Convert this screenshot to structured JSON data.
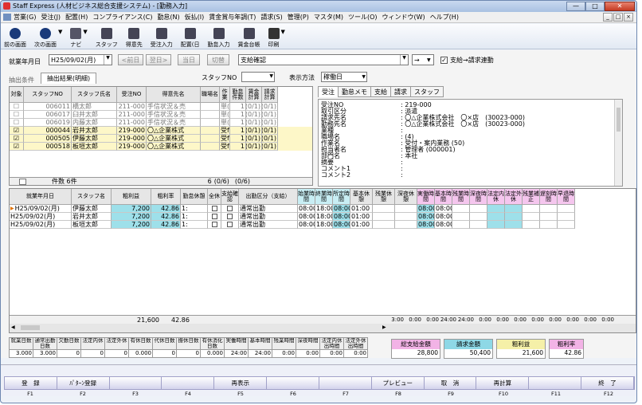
{
  "window": {
    "title": "Staff Express (人材ビジネス総合支援システム) - [勤務入力]",
    "controls": [
      "—",
      "□",
      "✕"
    ],
    "inner_controls": [
      "_",
      "□",
      "×"
    ]
  },
  "menu": [
    "営業(G)",
    "受注(J)",
    "配置(H)",
    "コンプライアンス(C)",
    "勤怠(N)",
    "仮払(I)",
    "賃金賞与年調(T)",
    "請求(S)",
    "管理(P)",
    "マスタ(M)",
    "ツール(O)",
    "ウィンドウ(W)",
    "ヘルプ(H)"
  ],
  "toolbar": [
    {
      "label": "前の画面",
      "icon": "back-arrow-icon"
    },
    {
      "label": "次の画面",
      "icon": "forward-arrow-icon"
    },
    {
      "label": "ナビ",
      "icon": "navi-icon"
    },
    {
      "label": "スタッフ",
      "icon": "staff-icon"
    },
    {
      "label": "得意先",
      "icon": "client-icon"
    },
    {
      "label": "受注入力",
      "icon": "order-entry-icon"
    },
    {
      "label": "配置(日",
      "icon": "placement-icon"
    },
    {
      "label": "勤怠入力",
      "icon": "attendance-icon"
    },
    {
      "label": "賃金台帳",
      "icon": "ledger-icon"
    },
    {
      "label": "印刷",
      "icon": "printer-icon"
    }
  ],
  "filter": {
    "date_label": "就業年月日",
    "date_value": "H25/09/02(月)",
    "prev_btn": "<前日",
    "next_btn": "翌日>",
    "today_btn": "当日",
    "switch_btn": "切替",
    "category_value": "支給確認",
    "arrow_value": "→",
    "checkbox_label": "支給→請求連動",
    "checkbox_checked": true
  },
  "extract": {
    "label": "抽出条件",
    "tab_label": "抽出結果(明細)",
    "staffno_label": "スタッフNO",
    "display_label": "表示方法",
    "display_value": "稼働日"
  },
  "upper_grid": {
    "headers": [
      "対象",
      "スタッフNO",
      "スタッフ氏名",
      "受注NO",
      "得意先名",
      "職場名",
      "作業",
      "勤怠件数",
      "賃金計算",
      "請求計算"
    ],
    "rows": [
      {
        "check": "☐",
        "no": "006011",
        "name": "橋太郎",
        "order": "211-000",
        "client": "手信状況＆売",
        "site": "",
        "work": "単(",
        "count": "1",
        "wage": "(0/1)",
        "bill": "(0/1)",
        "style": "gray"
      },
      {
        "check": "☐",
        "no": "006017",
        "name": "臼井太郎",
        "order": "211-000",
        "client": "手信状況＆売",
        "site": "",
        "work": "単(",
        "count": "1",
        "wage": "(0/1)",
        "bill": "(0/1)",
        "style": "gray"
      },
      {
        "check": "☐",
        "no": "006019",
        "name": "内藤太郎",
        "order": "211-000",
        "client": "手信状況＆売",
        "site": "",
        "work": "単(",
        "count": "1",
        "wage": "(0/1)",
        "bill": "(0/1)",
        "style": "gray"
      },
      {
        "check": "☑",
        "no": "000044",
        "name": "岩井太郎",
        "order": "219-000",
        "client": "〇△企業株式",
        "site": "",
        "work": "受f",
        "count": "1",
        "wage": "(0/1)",
        "bill": "(0/1)",
        "style": "yellow"
      },
      {
        "check": "☑",
        "no": "000505",
        "name": "伊藤太郎",
        "order": "219-000",
        "client": "〇△企業株式",
        "site": "",
        "work": "受f",
        "count": "1",
        "wage": "(0/1)",
        "bill": "(0/1)",
        "style": "yellow"
      },
      {
        "check": "☑",
        "no": "000518",
        "name": "板垣太郎",
        "order": "219-000",
        "client": "〇△企業株式",
        "site": "",
        "work": "受f",
        "count": "1",
        "wage": "(0/1)",
        "bill": "(0/1)",
        "style": "yellow"
      }
    ],
    "footer_count": "件数 6件",
    "footer_total": "6",
    "footer_wage": "(0/6)",
    "footer_bill": "(0/6)"
  },
  "detail": {
    "tabs": [
      "受注",
      "勤怠メモ",
      "支給",
      "請求",
      "スタッフ"
    ],
    "rows": [
      [
        "受注NO",
        ": 219-000"
      ],
      [
        "取引区分",
        ": 派遣"
      ],
      [
        "請求先名",
        ": 〇△企業株式会社　〇×店　(30023-000)"
      ],
      [
        "勤務先名",
        ": 〇△企業株式会社　〇×店　(30023-000)"
      ],
      [
        "業種",
        ":"
      ],
      [
        "職場名",
        ": (4)"
      ],
      [
        "作業名",
        ": 受付・案内業務 (50)"
      ],
      [
        "担当者名",
        ": 管理者 (000001)"
      ],
      [
        "部門名",
        ": 本社"
      ],
      [
        "摘要",
        ":"
      ],
      [
        "コメント1",
        ":"
      ],
      [
        "コメント2",
        ":"
      ]
    ]
  },
  "lower_grid": {
    "headers": [
      "就業年月日",
      "スタッフ名",
      "粗利益",
      "粗利率",
      "勤怠休憩",
      "全休",
      "支給確認",
      "出勤区分（支給）",
      "始業時間",
      "終業時間",
      "所定時間",
      "基本休憩",
      "残業休憩",
      "深夜休憩",
      "実働時間",
      "基本時間",
      "残業時間",
      "深夜時間",
      "法定内休",
      "法定外休",
      "残業補正",
      "遅刻時間",
      "早退時間"
    ],
    "rows": [
      {
        "date": "H25/09/02(月)",
        "name": "伊藤太郎",
        "profit": "7,200",
        "rate": "42.86",
        "rest": "1:",
        "kubun": "通常出勤",
        "start": "08:00",
        "end": "18:00",
        "sched": "08:00",
        "brest": "01:00",
        "actual": "08:00",
        "basic": "08:00"
      },
      {
        "date": "H25/09/02(月)",
        "name": "岩井太郎",
        "profit": "7,200",
        "rate": "42.86",
        "rest": "1:",
        "kubun": "通常出勤",
        "start": "08:00",
        "end": "18:00",
        "sched": "08:00",
        "brest": "01:00",
        "actual": "08:00",
        "basic": "08:00"
      },
      {
        "date": "H25/09/02(月)",
        "name": "板垣太郎",
        "profit": "7,200",
        "rate": "42.86",
        "rest": "1:",
        "kubun": "通常出勤",
        "start": "08:00",
        "end": "18:00",
        "sched": "08:00",
        "brest": "01:00",
        "actual": "08:00",
        "basic": "08:00"
      }
    ],
    "footer_profit": "21,600",
    "footer_rate": "42.86",
    "footer_times": [
      "3:00",
      "0:00",
      "0:00",
      "24:00",
      "24:00",
      "0:00",
      "0:00",
      "0:00",
      "0:00",
      "0:00",
      "0:00",
      "0:00",
      "0:00"
    ]
  },
  "summary": {
    "headers": [
      "就業日数",
      "通常出勤日数",
      "欠勤日数",
      "法定内休",
      "法定外休",
      "有休日数",
      "代休日数",
      "振休日数",
      "有休消化日数",
      "実働時間",
      "基本時間",
      "残業時間",
      "深夜時間",
      "法定内休出時間",
      "法定外休出時間"
    ],
    "values": [
      "3.000",
      "3.000",
      "0",
      "0",
      "0",
      "0.000",
      "0",
      "0",
      "0.000",
      "24:00",
      "24:00",
      "0:00",
      "0:00",
      "0:00",
      "0:00"
    ],
    "boxes": [
      {
        "label": "総支給金額",
        "value": "28,800",
        "color": "#f2b3e6"
      },
      {
        "label": "請求金額",
        "value": "50,400",
        "color": "#8ed8e6"
      },
      {
        "label": "粗利益",
        "value": "21,600",
        "color": "#f5f0a8"
      },
      {
        "label": "粗利率",
        "value": "42.86",
        "color": "#f2b3e6"
      }
    ]
  },
  "fkeys": [
    {
      "label": "登　録",
      "key": "F1"
    },
    {
      "label": "ﾊﾟﾀｰﾝ登録",
      "key": "F2"
    },
    {
      "label": "",
      "key": "F3"
    },
    {
      "label": "",
      "key": "F4"
    },
    {
      "label": "再表示",
      "key": "F5"
    },
    {
      "label": "",
      "key": "F6"
    },
    {
      "label": "",
      "key": "F7"
    },
    {
      "label": "プレビュー",
      "key": "F8"
    },
    {
      "label": "取　消",
      "key": "F9"
    },
    {
      "label": "再計算",
      "key": "F10"
    },
    {
      "label": "",
      "key": "F11"
    },
    {
      "label": "終　了",
      "key": "F12"
    }
  ]
}
